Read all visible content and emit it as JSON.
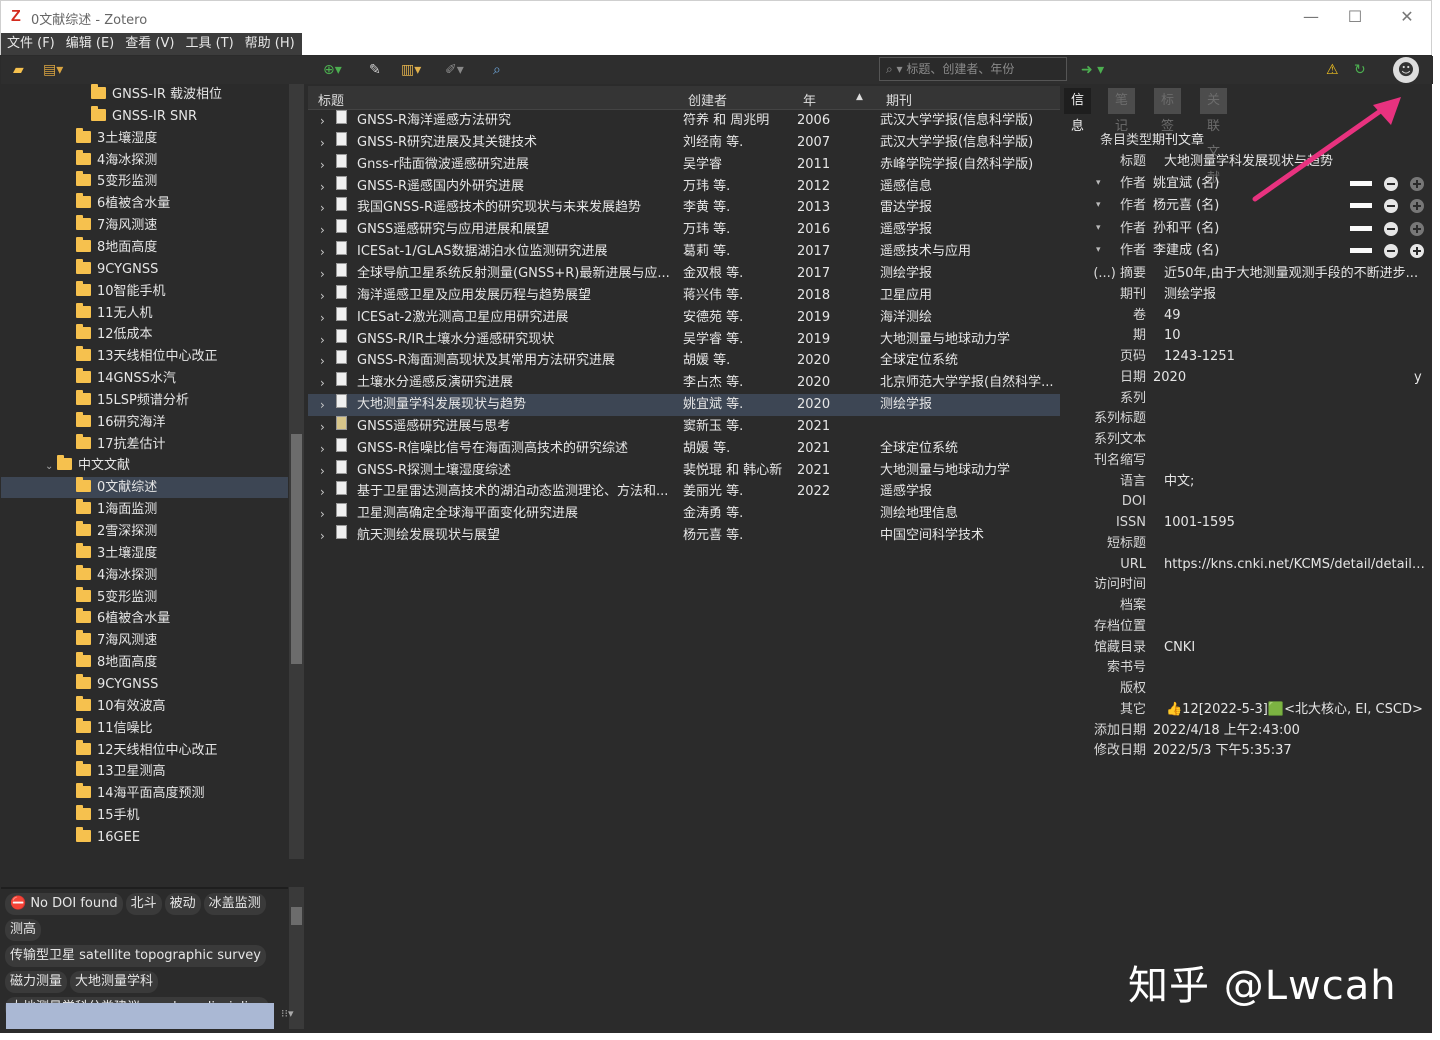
{
  "window": {
    "title": "0文献综述 - Zotero",
    "controls": [
      "—",
      "☐",
      "✕"
    ]
  },
  "menu": [
    "文件 (F)",
    "编辑 (E)",
    "查看 (V)",
    "工具 (T)",
    "帮助 (H)"
  ],
  "toolbar": {
    "search_placeholder": "标题、创建者、年份"
  },
  "collections": [
    {
      "label": "GNSS-IR 载波相位",
      "indent": 3
    },
    {
      "label": "GNSS-IR SNR",
      "indent": 3
    },
    {
      "label": "3土壤湿度",
      "indent": 2
    },
    {
      "label": "4海冰探测",
      "indent": 2
    },
    {
      "label": "5变形监测",
      "indent": 2
    },
    {
      "label": "6植被含水量",
      "indent": 2
    },
    {
      "label": "7海风测速",
      "indent": 2
    },
    {
      "label": "8地面高度",
      "indent": 2
    },
    {
      "label": "9CYGNSS",
      "indent": 2
    },
    {
      "label": "10智能手机",
      "indent": 2
    },
    {
      "label": "11无人机",
      "indent": 2
    },
    {
      "label": "12低成本",
      "indent": 2
    },
    {
      "label": "13天线相位中心改正",
      "indent": 2
    },
    {
      "label": "14GNSS水汽",
      "indent": 2
    },
    {
      "label": "15LSP频谱分析",
      "indent": 2
    },
    {
      "label": "16研究海洋",
      "indent": 2
    },
    {
      "label": "17抗差估计",
      "indent": 2
    },
    {
      "label": "中文文献",
      "indent": 1,
      "expanded": true
    },
    {
      "label": "0文献综述",
      "indent": 2,
      "selected": true
    },
    {
      "label": "1海面监测",
      "indent": 2
    },
    {
      "label": "2雪深探测",
      "indent": 2
    },
    {
      "label": "3土壤湿度",
      "indent": 2
    },
    {
      "label": "4海冰探测",
      "indent": 2
    },
    {
      "label": "5变形监测",
      "indent": 2
    },
    {
      "label": "6植被含水量",
      "indent": 2
    },
    {
      "label": "7海风测速",
      "indent": 2
    },
    {
      "label": "8地面高度",
      "indent": 2
    },
    {
      "label": "9CYGNSS",
      "indent": 2
    },
    {
      "label": "10有效波高",
      "indent": 2
    },
    {
      "label": "11信噪比",
      "indent": 2
    },
    {
      "label": "12天线相位中心改正",
      "indent": 2
    },
    {
      "label": "13卫星测高",
      "indent": 2
    },
    {
      "label": "14海平面高度预测",
      "indent": 2
    },
    {
      "label": "15手机",
      "indent": 2
    },
    {
      "label": "16GEE",
      "indent": 2
    }
  ],
  "tags": [
    [
      "No DOI found",
      "北斗",
      "被动",
      "冰盖监测"
    ],
    [
      "测高"
    ],
    [
      "传输型卫星 satellite topographic survey"
    ],
    [
      "磁力测量",
      "大地测量学科"
    ],
    [
      "大地测量学科分类建议 geodesy discipline"
    ]
  ],
  "columns": {
    "title": "标题",
    "creator": "创建者",
    "year": "年",
    "journal": "期刊"
  },
  "items": [
    {
      "title": "GNSS-R海洋遥感方法研究",
      "creator": "符养 和 周兆明",
      "year": "2006",
      "journal": "武汉大学学报(信息科学版)"
    },
    {
      "title": "GNSS-R研究进展及其关键技术",
      "creator": "刘经南 等.",
      "year": "2007",
      "journal": "武汉大学学报(信息科学版)"
    },
    {
      "title": "Gnss-r陆面微波遥感研究进展",
      "creator": "吴学睿",
      "year": "2011",
      "journal": "赤峰学院学报(自然科学版)"
    },
    {
      "title": "GNSS-R遥感国内外研究进展",
      "creator": "万玮 等.",
      "year": "2012",
      "journal": "遥感信息"
    },
    {
      "title": "我国GNSS-R遥感技术的研究现状与未来发展趋势",
      "creator": "李黄 等.",
      "year": "2013",
      "journal": "雷达学报"
    },
    {
      "title": "GNSS遥感研究与应用进展和展望",
      "creator": "万玮 等.",
      "year": "2016",
      "journal": "遥感学报"
    },
    {
      "title": "ICESat-1/GLAS数据湖泊水位监测研究进展",
      "creator": "葛莉 等.",
      "year": "2017",
      "journal": "遥感技术与应用"
    },
    {
      "title": "全球导航卫星系统反射测量(GNSS+R)最新进展与应...",
      "creator": "金双根 等.",
      "year": "2017",
      "journal": "测绘学报"
    },
    {
      "title": "海洋遥感卫星及应用发展历程与趋势展望",
      "creator": "蒋兴伟 等.",
      "year": "2018",
      "journal": "卫星应用"
    },
    {
      "title": "ICESat-2激光测高卫星应用研究进展",
      "creator": "安德苑 等.",
      "year": "2019",
      "journal": "海洋测绘"
    },
    {
      "title": "GNSS-R/IR土壤水分遥感研究现状",
      "creator": "吴学睿 等.",
      "year": "2019",
      "journal": "大地测量与地球动力学"
    },
    {
      "title": "GNSS-R海面测高现状及其常用方法研究进展",
      "creator": "胡媛 等.",
      "year": "2020",
      "journal": "全球定位系统"
    },
    {
      "title": "土壤水分遥感反演研究进展",
      "creator": "李占杰 等.",
      "year": "2020",
      "journal": "北京师范大学学报(自然科学..."
    },
    {
      "title": "大地测量学科发展现状与趋势",
      "creator": "姚宜斌 等.",
      "year": "2020",
      "journal": "测绘学报",
      "selected": true
    },
    {
      "title": "GNSS遥感研究进展与思考",
      "creator": "窦新玉 等.",
      "year": "2021",
      "journal": "",
      "icon": "web"
    },
    {
      "title": "GNSS-R信噪比信号在海面测高技术的研究综述",
      "creator": "胡媛 等.",
      "year": "2021",
      "journal": "全球定位系统"
    },
    {
      "title": "GNSS-R探测土壤湿度综述",
      "creator": "裴悦琨 和 韩心新",
      "year": "2021",
      "journal": "大地测量与地球动力学"
    },
    {
      "title": "基于卫星雷达测高技术的湖泊动态监测理论、方法和...",
      "creator": "姜丽光 等.",
      "year": "2022",
      "journal": "遥感学报"
    },
    {
      "title": "卫星测高确定全球海平面变化研究进展",
      "creator": "金涛勇 等.",
      "year": "",
      "journal": "测绘地理信息"
    },
    {
      "title": "航天测绘发展现状与展望",
      "creator": "杨元喜 等.",
      "year": "",
      "journal": "中国空间科学技术"
    }
  ],
  "item_pane": {
    "tabs": [
      "信息",
      "笔记",
      "标签",
      "关联文献"
    ],
    "item_type_label": "条目类型",
    "item_type": "期刊文章",
    "title_label": "标题",
    "title": "大地测量学科发展现状与趋势",
    "creators": [
      {
        "role": "作者",
        "name": "姚宜斌 (名)"
      },
      {
        "role": "作者",
        "name": "杨元喜 (名)"
      },
      {
        "role": "作者",
        "name": "孙和平 (名)"
      },
      {
        "role": "作者",
        "name": "李建成 (名)"
      }
    ],
    "fields": [
      {
        "label": "(...) 摘要",
        "value": "近50年,由于大地测量观测手段的不断进步..."
      },
      {
        "label": "期刊",
        "value": "测绘学报"
      },
      {
        "label": "卷",
        "value": "49"
      },
      {
        "label": "期",
        "value": "10"
      },
      {
        "label": "页码",
        "value": "1243-1251"
      },
      {
        "label": "日期",
        "value": "2020",
        "extra": "y"
      },
      {
        "label": "系列",
        "value": ""
      },
      {
        "label": "系列标题",
        "value": ""
      },
      {
        "label": "系列文本",
        "value": ""
      },
      {
        "label": "刊名缩写",
        "value": ""
      },
      {
        "label": "语言",
        "value": "中文;"
      },
      {
        "label": "DOI",
        "value": ""
      },
      {
        "label": "ISSN",
        "value": "1001-1595"
      },
      {
        "label": "短标题",
        "value": ""
      },
      {
        "label": "URL",
        "value": "https://kns.cnki.net/KCMS/detail/detail...."
      },
      {
        "label": "访问时间",
        "value": ""
      },
      {
        "label": "档案",
        "value": ""
      },
      {
        "label": "存档位置",
        "value": ""
      },
      {
        "label": "馆藏目录",
        "value": "CNKI"
      },
      {
        "label": "索书号",
        "value": ""
      },
      {
        "label": "版权",
        "value": ""
      },
      {
        "label": "其它",
        "value": "👍12[2022-5-3]🟩<北大核心, EI, CSCD>"
      },
      {
        "label": "添加日期",
        "value": "2022/4/18 上午2:43:00"
      },
      {
        "label": "修改日期",
        "value": "2022/5/3 下午5:35:37"
      }
    ]
  },
  "watermark": "知乎 @Lwcah",
  "colors": {
    "accent_arrow": "#e8327f",
    "selection": "#3d4654",
    "folder": "#f6c14e"
  }
}
